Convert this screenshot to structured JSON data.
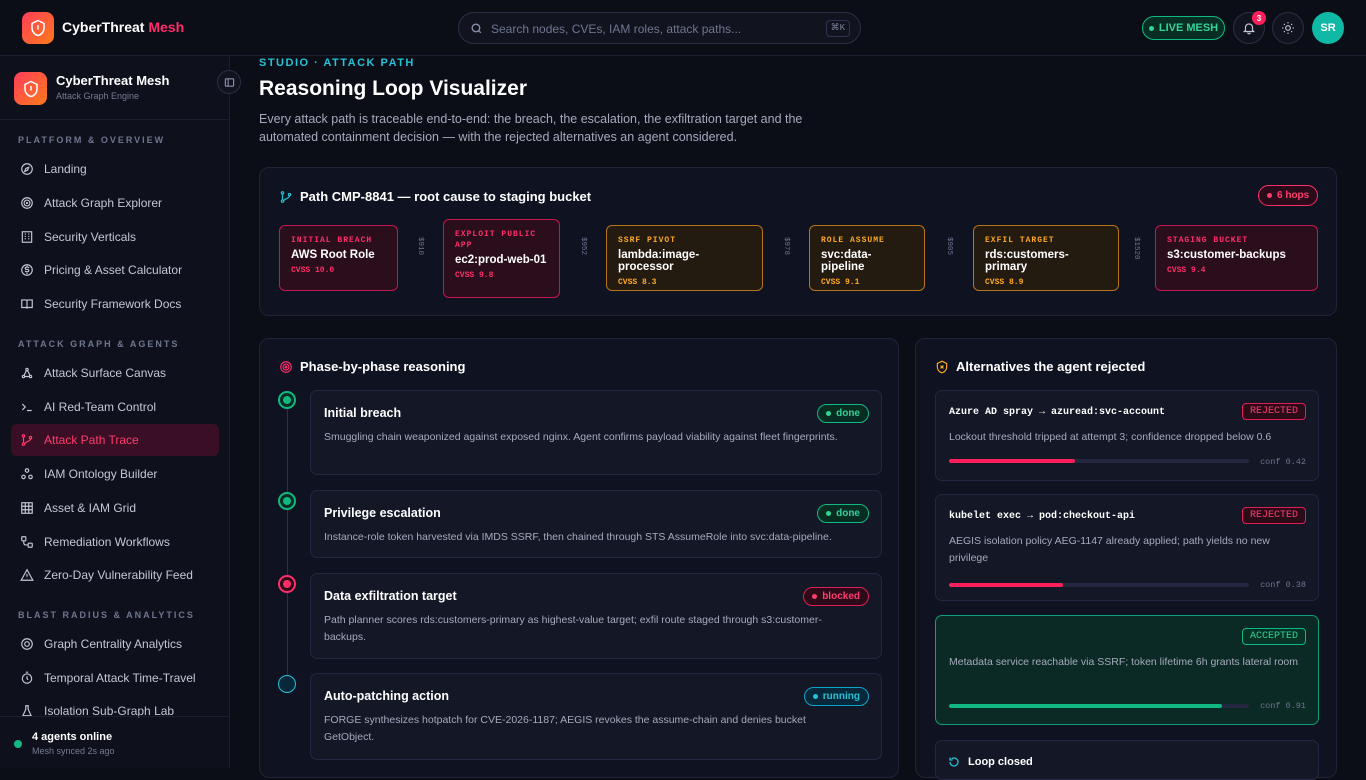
{
  "brand": {
    "name": "CyberThreat",
    "accent": "Mesh"
  },
  "search": {
    "placeholder": "Search nodes, CVEs, IAM roles, attack paths...",
    "shortcut": "⌘K"
  },
  "header": {
    "live_label": "LIVE MESH",
    "notifications": "3",
    "avatar_initials": "SR"
  },
  "sidebar": {
    "title": "CyberThreat Mesh",
    "subtitle": "Attack Graph Engine",
    "sections": [
      {
        "label": "PLATFORM & OVERVIEW",
        "items": [
          {
            "label": "Landing",
            "icon": "compass-icon"
          },
          {
            "label": "Attack Graph Explorer",
            "icon": "radar-icon"
          },
          {
            "label": "Security Verticals",
            "icon": "building-icon"
          },
          {
            "label": "Pricing & Asset Calculator",
            "icon": "dollar-icon"
          },
          {
            "label": "Security Framework Docs",
            "icon": "book-icon"
          }
        ]
      },
      {
        "label": "ATTACK GRAPH & AGENTS",
        "items": [
          {
            "label": "Attack Surface Canvas",
            "icon": "graph-icon"
          },
          {
            "label": "AI Red-Team Control",
            "icon": "terminal-icon"
          },
          {
            "label": "Attack Path Trace",
            "icon": "git-branch-icon",
            "active": true
          },
          {
            "label": "IAM Ontology Builder",
            "icon": "cluster-icon"
          },
          {
            "label": "Asset & IAM Grid",
            "icon": "grid-icon"
          },
          {
            "label": "Remediation Workflows",
            "icon": "workflow-icon"
          },
          {
            "label": "Zero-Day Vulnerability Feed",
            "icon": "warning-icon"
          }
        ]
      },
      {
        "label": "BLAST RADIUS & ANALYTICS",
        "items": [
          {
            "label": "Graph Centrality Analytics",
            "icon": "target-icon"
          },
          {
            "label": "Temporal Attack Time-Travel",
            "icon": "timer-icon"
          },
          {
            "label": "Isolation Sub-Graph Lab",
            "icon": "flask-icon"
          }
        ]
      }
    ],
    "footer": {
      "status": "4 agents online",
      "sync": "Mesh synced 2s ago"
    }
  },
  "page": {
    "eyebrow": "STUDIO · ATTACK PATH",
    "title": "Reasoning Loop Visualizer",
    "description": "Every attack path is traceable end-to-end: the breach, the escalation, the exfiltration target and the automated containment decision — with the rejected alternatives an agent considered."
  },
  "path": {
    "title": "Path CMP-8841 — root cause to staging bucket",
    "hops": "6 hops",
    "nodes": [
      {
        "label": "INITIAL BREACH",
        "name": "AWS Root Role",
        "cvss": "CVSS 10.0",
        "tone": "red"
      },
      {
        "label": "EXPLOIT PUBLIC APP",
        "name": "ec2:prod-web-01",
        "cvss": "CVSS 9.8",
        "tone": "red"
      },
      {
        "label": "SSRF PIVOT",
        "name": "lambda:image-processor",
        "cvss": "CVSS 8.3",
        "tone": "orange"
      },
      {
        "label": "ROLE ASSUME",
        "name": "svc:data-pipeline",
        "cvss": "CVSS 9.1",
        "tone": "orange"
      },
      {
        "label": "EXFIL TARGET",
        "name": "rds:customers-primary",
        "cvss": "CVSS 8.9",
        "tone": "orange"
      },
      {
        "label": "STAGING BUCKET",
        "name": "s3:customer-backups",
        "cvss": "CVSS 9.4",
        "tone": "red"
      }
    ],
    "edges": [
      "$910",
      "$952",
      "$978",
      "$905",
      "$1520"
    ]
  },
  "phases": {
    "title": "Phase-by-phase reasoning",
    "items": [
      {
        "title": "Initial breach",
        "status": "done",
        "desc": "Smuggling chain weaponized against exposed nginx. Agent confirms payload viability against fleet fingerprints."
      },
      {
        "title": "Privilege escalation",
        "status": "done",
        "desc": "Instance-role token harvested via IMDS SSRF, then chained through STS AssumeRole into svc:data-pipeline."
      },
      {
        "title": "Data exfiltration target",
        "status": "blocked",
        "desc": "Path planner scores rds:customers-primary as highest-value target; exfil route staged through s3:customer-backups."
      },
      {
        "title": "Auto-patching action",
        "status": "running",
        "desc": "FORGE synthesizes hotpatch for CVE-2026-1187; AEGIS revokes the assume-chain and denies bucket GetObject."
      }
    ]
  },
  "alternatives": {
    "title": "Alternatives the agent rejected",
    "items": [
      {
        "title": "Azure AD spray → azuread:svc-account",
        "status": "REJECTED",
        "desc": "Lockout threshold tripped at attempt 3; confidence dropped below 0.6",
        "conf_label": "conf 0.42",
        "confidence": 0.42
      },
      {
        "title": "kubelet exec → pod:checkout-api",
        "status": "REJECTED",
        "desc": "AEGIS isolation policy AEG-1147 already applied; path yields no new privilege",
        "conf_label": "conf 0.38",
        "confidence": 0.38
      },
      {
        "title": "",
        "status": "ACCEPTED",
        "desc": "Metadata service reachable via SSRF; token lifetime 6h grants lateral room",
        "conf_label": "conf 0.91",
        "confidence": 0.91
      }
    ],
    "loop_label": "Loop closed"
  },
  "colors": {
    "accent": "#ff2d6a",
    "success": "#10b981",
    "warning": "#ffaa22",
    "info": "#22c3d6",
    "background": "#0b0d17"
  }
}
